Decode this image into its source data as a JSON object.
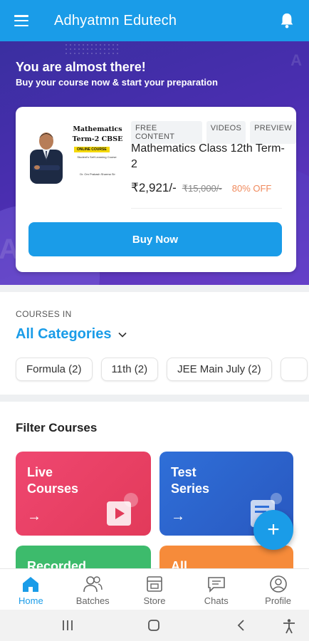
{
  "app": {
    "title": "Adhyatmn Edutech"
  },
  "icons": {
    "menu": "hamburger-menu-icon",
    "notifications": "bell-icon"
  },
  "colors": {
    "primary": "#1a9ce8",
    "hero": "#4a2eb0",
    "discount": "#f08a5d"
  },
  "hero": {
    "title": "You are almost there!",
    "subtitle": "Buy your course now & start your preparation",
    "course": {
      "thumbnail": {
        "line1": "Mathematics",
        "line2": "Term-2 CBSE",
        "badge": "ONLINE COURSE",
        "desc": "Student's Self Learning Course",
        "author": "Dr. Om Prakash Sharma Sir"
      },
      "tags": [
        "FREE CONTENT",
        "VIDEOS",
        "PREVIEW"
      ],
      "name": "Mathematics Class 12th Term-2",
      "price": "₹2,921/-",
      "old_price": "₹15,000/-",
      "discount": "80% OFF",
      "buy_label": "Buy Now"
    }
  },
  "courses_in": {
    "label": "COURSES IN",
    "selected": "All Categories",
    "chips": [
      "Formula (2)",
      "11th (2)",
      "JEE Main July (2)"
    ]
  },
  "filter": {
    "title": "Filter Courses",
    "tiles": [
      {
        "line1": "Live",
        "line2": "Courses",
        "arrow": "→"
      },
      {
        "line1": "Test",
        "line2": "Series",
        "arrow": "→"
      },
      {
        "line1": "Recorded",
        "line2": ""
      },
      {
        "line1": "All",
        "line2": ""
      }
    ],
    "fab": "+"
  },
  "bottom_nav": [
    {
      "label": "Home",
      "icon": "home-icon",
      "active": true
    },
    {
      "label": "Batches",
      "icon": "batches-icon",
      "active": false
    },
    {
      "label": "Store",
      "icon": "store-icon",
      "active": false
    },
    {
      "label": "Chats",
      "icon": "chats-icon",
      "active": false
    },
    {
      "label": "Profile",
      "icon": "profile-icon",
      "active": false
    }
  ]
}
